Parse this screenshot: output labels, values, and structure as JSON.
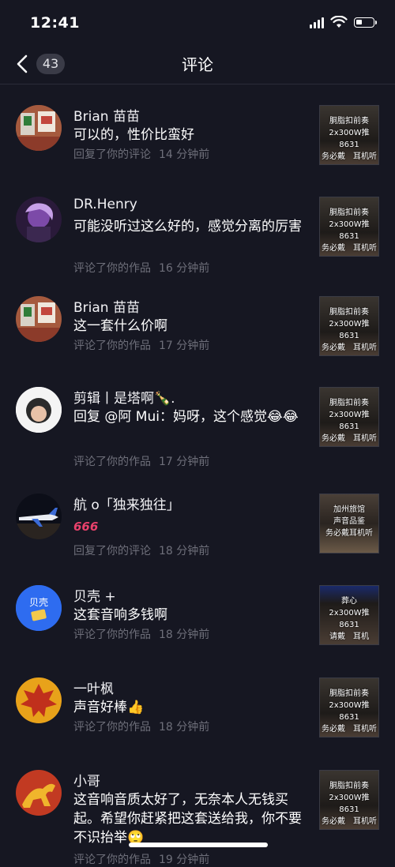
{
  "status": {
    "time": "12:41"
  },
  "header": {
    "title": "评论",
    "count": "43"
  },
  "items": [
    {
      "name": "Brian 苗苗",
      "content": "可以的，性价比蛮好",
      "action": "回复了你的评论",
      "time": "14 分钟前",
      "thumb": "胴脂扣前奏\n2x300W推8631\n务必戴　耳机听"
    },
    {
      "name": "DR.Henry",
      "content": "可能没听过这么好的，感觉分离的厉害",
      "action": "评论了你的作品",
      "time": "16 分钟前",
      "thumb": "胴脂扣前奏\n2x300W推8631\n务必戴　耳机听"
    },
    {
      "name": "Brian 苗苗",
      "content": "这一套什么价啊",
      "action": "评论了你的作品",
      "time": "17 分钟前",
      "thumb": "胴脂扣前奏\n2x300W推8631\n务必戴　耳机听"
    },
    {
      "name": "剪辑丨是塔啊🍾.",
      "content": "回复 @阿 Mui：妈呀，这个感觉😂😂",
      "action": "评论了你的作品",
      "time": "17 分钟前",
      "thumb": "胴脂扣前奏\n2x300W推8631\n务必戴　耳机听"
    },
    {
      "name": "航 o「独来独往」",
      "content": "666",
      "action": "回复了你的评论",
      "time": "18 分钟前",
      "thumb": "加州旅馆\n声音品鉴\n务必戴耳机听"
    },
    {
      "name": "贝壳 +",
      "content": "这套音响多钱啊",
      "action": "评论了你的作品",
      "time": "18 分钟前",
      "thumb": "葬心\n2x300W推8631\n请戴　耳机"
    },
    {
      "name": "一叶枫",
      "content": "声音好棒👍",
      "action": "评论了你的作品",
      "time": "18 分钟前",
      "thumb": "胴脂扣前奏\n2x300W推8631\n务必戴　耳机听"
    },
    {
      "name": "小哥",
      "content": "这音响音质太好了，无奈本人无钱买起。希望你赶紧把这套送给我，你不要不识抬举🙄",
      "action": "评论了你的作品",
      "time": "19 分钟前",
      "thumb": "胴脂扣前奏\n2x300W推8631\n务必戴　耳机听"
    }
  ],
  "avatar_badge": "贝壳",
  "colors": {
    "background": "#161722",
    "meta": "#6e6f7a",
    "divider": "#2b2c38"
  }
}
